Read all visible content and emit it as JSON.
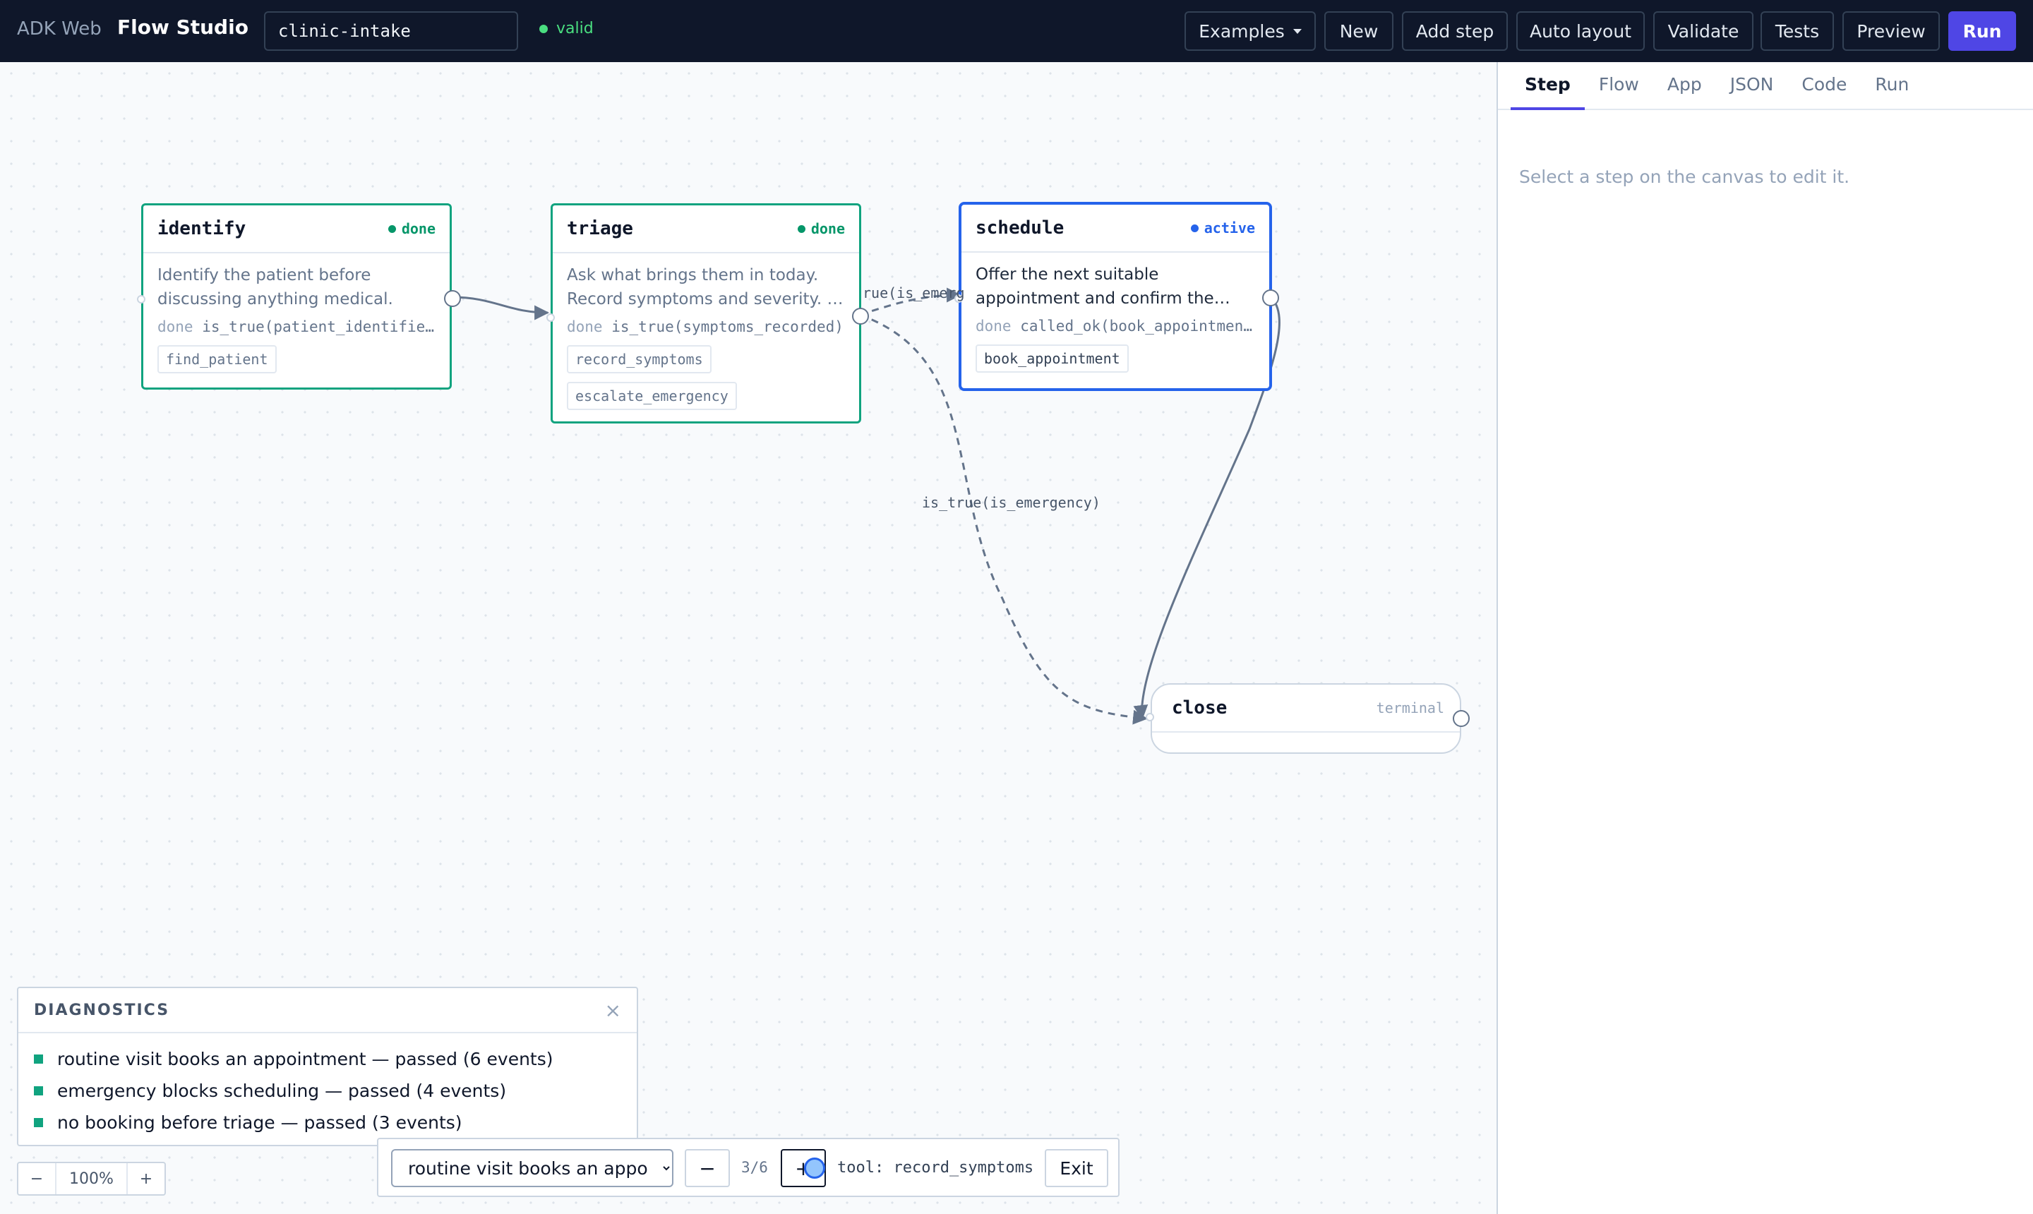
{
  "header": {
    "brand_sub": "ADK Web",
    "brand": "Flow Studio",
    "flow_name": "clinic-intake",
    "status": "valid",
    "buttons": {
      "examples": "Examples",
      "new": "New",
      "add_step": "Add step",
      "auto_layout": "Auto layout",
      "validate": "Validate",
      "tests": "Tests",
      "preview": "Preview",
      "run": "Run"
    }
  },
  "canvas": {
    "nodes": [
      {
        "name": "identify",
        "status": "done",
        "description": "Identify the patient before discussing anything medical.",
        "cond_key": "done",
        "cond_expr": "is_true(patient_identified)",
        "tools": [
          "find_patient"
        ]
      },
      {
        "name": "triage",
        "status": "done",
        "description": "Ask what brings them in today. Record symptoms and severity. …",
        "cond_key": "done",
        "cond_expr": "is_true(symptoms_recorded)",
        "tools": [
          "record_symptoms",
          "escalate_emergency"
        ]
      },
      {
        "name": "schedule",
        "status": "active",
        "description": "Offer the next suitable appointment and confirm the…",
        "cond_key": "done",
        "cond_expr": "called_ok(book_appointment)",
        "tools": [
          "book_appointment"
        ]
      }
    ],
    "terminal": {
      "name": "close",
      "tag": "terminal"
    },
    "edge_labels": {
      "triage_schedule": "rue(is_emerg",
      "triage_close": "is_true(is_emergency)"
    }
  },
  "diagnostics": {
    "title": "DIAGNOSTICS",
    "close": "×",
    "items": [
      "routine visit books an appointment — passed (6 events)",
      "emergency blocks scheduling — passed (4 events)",
      "no booking before triage — passed (3 events)"
    ]
  },
  "zoom": {
    "minus": "−",
    "value": "100%",
    "plus": "+"
  },
  "replay": {
    "selected_test": "routine visit books an appointment",
    "prev": "−",
    "position": "3/6",
    "next": "+",
    "current_event": "tool: record_symptoms",
    "exit": "Exit"
  },
  "panel": {
    "tabs": [
      "Step",
      "Flow",
      "App",
      "JSON",
      "Code",
      "Run"
    ],
    "selected_tab": "Step",
    "hint": "Select a step on the canvas to edit it."
  },
  "colors": {
    "topbar": "#0f172a",
    "accent": "#4f46e5",
    "done": "#10a37f",
    "active": "#2563eb",
    "valid": "#4ade80"
  }
}
